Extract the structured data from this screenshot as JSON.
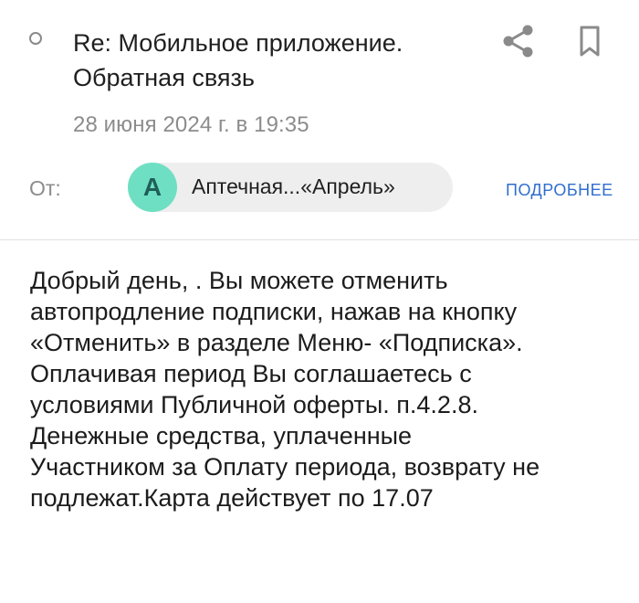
{
  "email": {
    "subject": "Re: Мобильное приложение.\nОбратная связь",
    "date": "28 июня 2024 г. в 19:35",
    "from_label": "От:",
    "sender": {
      "avatar_letter": "А",
      "name": "Аптечная...«Апрель»"
    },
    "details_label": "ПОДРОБНЕЕ",
    "body": "Добрый день, . Вы можете отменить\nавтопродление подписки, нажав на кнопку\n«Отменить» в разделе Меню-  «Подписка».\nОплачивая период Вы соглашаетесь с\nусловиями Публичной оферты. п.4.2.8.\nДенежные средства, уплаченные\nУчастником за Оплату периода, возврату не\nподлежат.Карта действует  по 17.07"
  },
  "icons": {
    "read_indicator": "circle-outline-icon",
    "share": "share-icon",
    "bookmark": "bookmark-icon"
  },
  "colors": {
    "avatar_bg": "#6fdfc3",
    "avatar_text": "#1f5f57",
    "link": "#2f6ecf",
    "secondary_text": "#8c8c8c",
    "chip_bg": "#eeeeee"
  }
}
